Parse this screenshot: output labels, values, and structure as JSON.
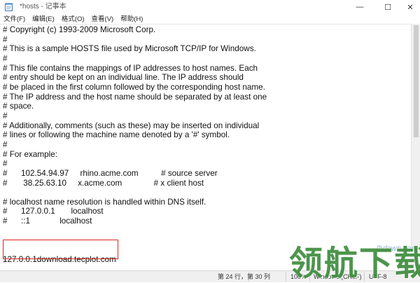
{
  "window": {
    "title": "*hosts - 记事本",
    "app_icon": "notepad-icon",
    "controls": {
      "minimize": "—",
      "maximize": "☐",
      "close": "✕"
    }
  },
  "menu": [
    {
      "label": "文件(F)"
    },
    {
      "label": "编辑(E)"
    },
    {
      "label": "格式(O)"
    },
    {
      "label": "查看(V)"
    },
    {
      "label": "帮助(H)"
    }
  ],
  "editor": {
    "content": "# Copyright (c) 1993-2009 Microsoft Corp.\n#\n# This is a sample HOSTS file used by Microsoft TCP/IP for Windows.\n#\n# This file contains the mappings of IP addresses to host names. Each\n# entry should be kept on an individual line. The IP address should\n# be placed in the first column followed by the corresponding host name.\n# The IP address and the host name should be separated by at least one\n# space.\n#\n# Additionally, comments (such as these) may be inserted on individual\n# lines or following the machine name denoted by a '#' symbol.\n#\n# For example:\n#\n#      102.54.94.97     rhino.acme.com          # source server\n#       38.25.63.10     x.acme.com              # x client host\n\n# localhost name resolution is handled within DNS itself.\n#\t127.0.0.1       localhost\n#\t::1             localhost\n\n\n\n127.0.0.1download.tecplot.com",
    "highlighted_line": "127.0.0.1download.tecplot.com",
    "highlight_color": "#d9261c"
  },
  "status": {
    "position": "第 24 行，第 30 列",
    "zoom": "100%",
    "line_ending": "Windows (CRLF)",
    "encoding": "UTF-8"
  },
  "watermark": {
    "logo_text": "领航下载",
    "url": "lhdown.com",
    "color": "#3a8a3a"
  }
}
